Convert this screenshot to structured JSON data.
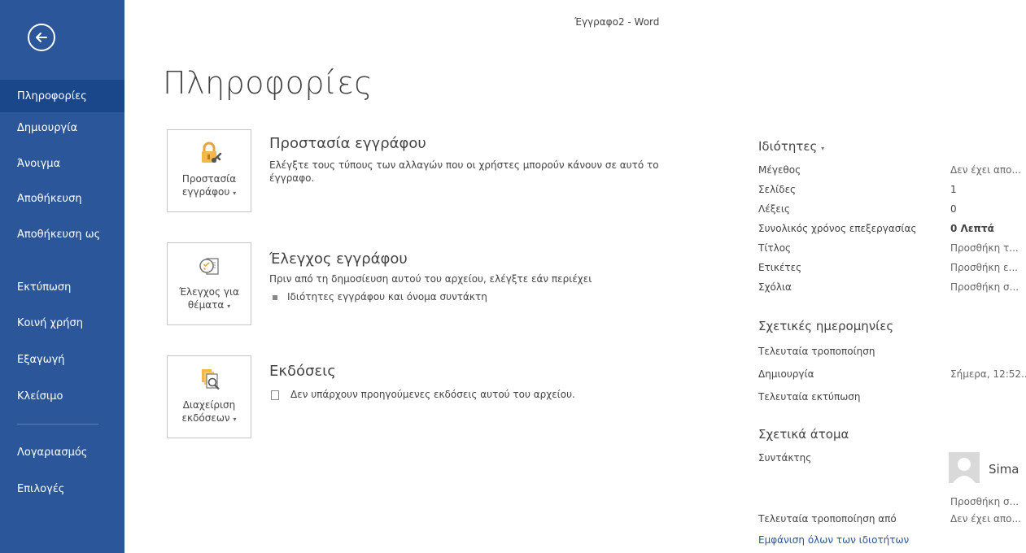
{
  "window": {
    "title": "Έγγραφο2 - Word"
  },
  "sidebar": {
    "items": [
      {
        "label": "Πληροφορίες"
      },
      {
        "label": "Δημιουργία"
      },
      {
        "label": "Άνοιγμα"
      },
      {
        "label": "Αποθήκευση"
      },
      {
        "label": "Αποθήκευση ως"
      },
      {
        "label": "Εκτύπωση"
      },
      {
        "label": "Κοινή χρήση"
      },
      {
        "label": "Εξαγωγή"
      },
      {
        "label": "Κλείσιμο"
      },
      {
        "label": "Λογαριασμός"
      },
      {
        "label": "Επιλογές"
      }
    ],
    "selected": "Πληροφορίες"
  },
  "main": {
    "title": "Πληροφορίες",
    "sections": [
      {
        "button_line1": "Προστασία",
        "button_line2": "εγγράφου",
        "icon": "lock-icon",
        "title": "Προστασία εγγράφου",
        "text": "Ελέγξτε τους τύπους των αλλαγών που οι χρήστες μπορούν κάνουν σε αυτό το έγγραφο."
      },
      {
        "button_line1": "Έλεγχος για",
        "button_line2": "θέματα",
        "icon": "inspect-document-icon",
        "title": "Έλεγχος εγγράφου",
        "text": "Πριν από τη δημοσίευση αυτού του αρχείου, ελέγξτε εάν περιέχει",
        "bullet": "Ιδιότητες εγγράφου και όνομα συντάκτη"
      },
      {
        "button_line1": "Διαχείριση",
        "button_line2": "εκδόσεων",
        "icon": "versions-icon",
        "title": "Εκδόσεις",
        "text": "Δεν υπάρχουν προηγούμενες εκδόσεις αυτού του αρχείου."
      }
    ]
  },
  "properties": {
    "title": "Ιδιότητες",
    "rows": [
      {
        "label": "Μέγεθος",
        "value": "Δεν έχει απο..."
      },
      {
        "label": "Σελίδες",
        "value": "1"
      },
      {
        "label": "Λέξεις",
        "value": "0"
      },
      {
        "label": "Συνολικός χρόνος επεξεργασίας",
        "value": "0 Λεπτά"
      },
      {
        "label": "Τίτλος",
        "value": "Προσθήκη τ..."
      },
      {
        "label": "Ετικέτες",
        "value": "Προσθήκη ε..."
      },
      {
        "label": "Σχόλια",
        "value": "Προσθήκη σ..."
      }
    ],
    "dates_title": "Σχετικές ημερομηνίες",
    "dates": [
      {
        "label": "Τελευταία τροποποίηση",
        "value": ""
      },
      {
        "label": "Δημιουργία",
        "value": "Σήμερα, 12:52..."
      },
      {
        "label": "Τελευταία εκτύπωση",
        "value": ""
      }
    ],
    "people_title": "Σχετικά άτομα",
    "author_label": "Συντάκτης",
    "author_name": "Sima",
    "add_author": "Προσθήκη σ...",
    "last_modified_by_label": "Τελευταία τροποποίηση από",
    "last_modified_by_value": "Δεν έχει απο...",
    "show_all_link": "Εμφάνιση όλων των ιδιοτήτων"
  }
}
